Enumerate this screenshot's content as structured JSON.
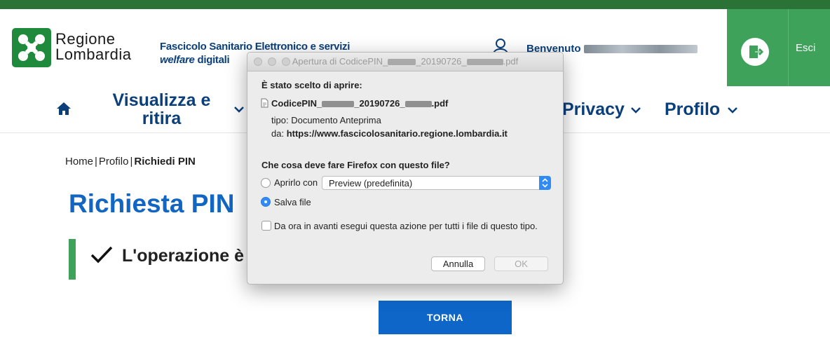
{
  "header": {
    "logo_line1": "Regione",
    "logo_line2": "Lombardia",
    "fse_title": "Fascicolo Sanitario Elettronico e servizi",
    "fse_sub_italic": "welfare",
    "fse_sub_rest": " digitali",
    "welcome": "Benvenuto",
    "exit_label": "Esci"
  },
  "nav": {
    "item1_line1": "Visualizza e",
    "item1_line2": "ritira",
    "privacy": "Privacy",
    "profilo": "Profilo"
  },
  "breadcrumb": {
    "home": "Home",
    "profilo": "Profilo",
    "current": "Richiedi PIN",
    "sep": "|"
  },
  "main": {
    "title": "Richiesta PIN",
    "operation_text": "L'operazione è",
    "torna_label": "TORNA"
  },
  "dialog": {
    "title_prefix": "Apertura di CodicePIN_",
    "title_mid": "_20190726_",
    "title_suffix": ".pdf",
    "chosen_label": "È stato scelto di aprire:",
    "file_prefix": "CodicePIN_",
    "file_mid": "_20190726_",
    "file_suffix": ".pdf",
    "type_label": "tipo:",
    "type_value": "Documento Anteprima",
    "from_label": "da:",
    "from_value": "https://www.fascicolosanitario.regione.lombardia.it",
    "question": "Che cosa deve fare Firefox con questo file?",
    "open_with_label": "Aprirlo con",
    "open_with_value": "Preview (predefinita)",
    "save_label": "Salva file",
    "remember_label": "Da ora in avanti esegui questa azione per tutti i file di questo tipo.",
    "cancel_label": "Annulla",
    "ok_label": "OK"
  },
  "colors": {
    "brand_green": "#3ea25b",
    "dark_green": "#2b7237",
    "navy": "#0b3f7a",
    "blue": "#1166c4",
    "button_blue": "#0e66c9"
  },
  "icons": {
    "home": "home-icon",
    "user": "user-icon",
    "exit": "exit-icon",
    "check": "check-icon",
    "file": "pdf-file-icon"
  }
}
